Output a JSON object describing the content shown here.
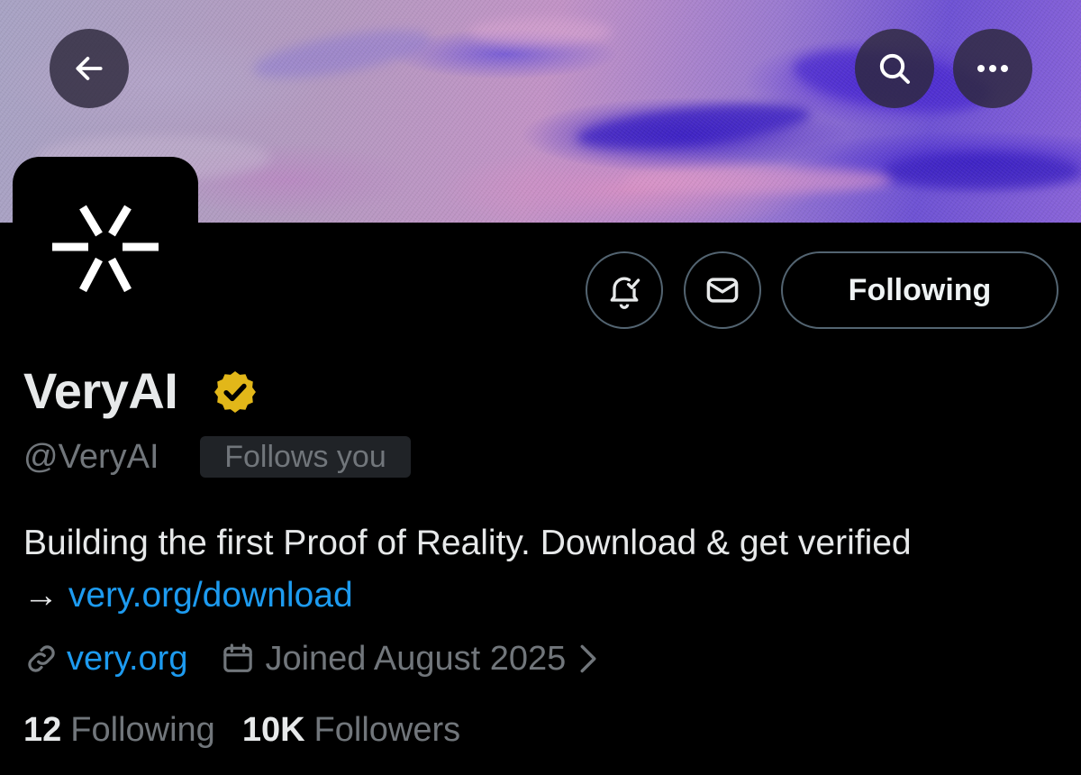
{
  "profile": {
    "display_name": "VeryAI",
    "handle": "@VeryAI",
    "follows_you_label": "Follows you",
    "bio_text": "Building the first Proof of Reality. Download & get verified",
    "bio_arrow": "→",
    "bio_link": "very.org/download",
    "website": "very.org",
    "joined": "Joined August 2025",
    "following_count": "12",
    "following_label": "Following",
    "followers_count": "10K",
    "followers_label": "Followers"
  },
  "actions": {
    "following_button_label": "Following"
  },
  "icons": {
    "back": "arrow-left-icon",
    "search": "search-icon",
    "more": "more-horizontal-icon",
    "notify": "bell-check-icon",
    "message": "envelope-icon",
    "verified": "verified-badge-icon",
    "link": "link-icon",
    "calendar": "calendar-icon",
    "chevron": "chevron-right-icon"
  },
  "colors": {
    "background": "#000000",
    "accent_link": "#1d9bf0",
    "secondary_text": "#71767b",
    "verified_gold": "#e2b719"
  }
}
